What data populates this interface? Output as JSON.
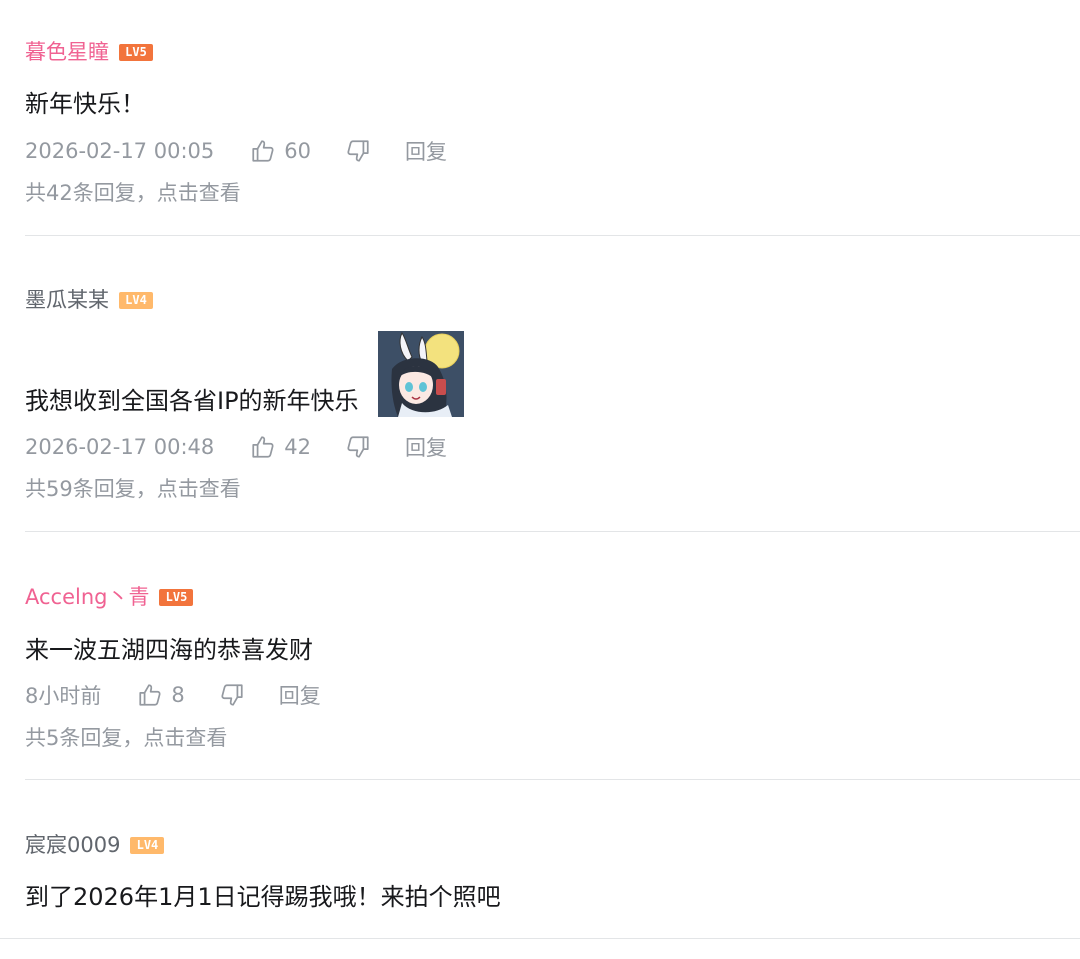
{
  "comments": [
    {
      "username": "暮色星瞳",
      "level": "LV5",
      "content": "新年快乐！",
      "time": "2026-02-17 00:05",
      "likes": "60",
      "reply_label": "回复",
      "sub_replies": "共42条回复，点击查看"
    },
    {
      "username": "墨瓜某某",
      "level": "LV4",
      "content": "我想收到全国各省IP的新年快乐",
      "sticker": "anime-bunny-girl-sticker",
      "time": "2026-02-17 00:48",
      "likes": "42",
      "reply_label": "回复",
      "sub_replies": "共59条回复，点击查看"
    },
    {
      "username": "Accelng丶青",
      "level": "LV5",
      "content": "来一波五湖四海的恭喜发财",
      "time": "8小时前",
      "likes": "8",
      "reply_label": "回复",
      "sub_replies": "共5条回复，点击查看"
    },
    {
      "username": "宸宸0009",
      "level": "LV4",
      "content": "到了2026年1月1日记得踢我哦！来拍个照吧"
    }
  ],
  "colors": {
    "vip_name": "#f06292",
    "normal_name": "#61666d",
    "meta": "#9499a0",
    "lv5": "#f2743c",
    "lv4": "#ffb96b"
  }
}
